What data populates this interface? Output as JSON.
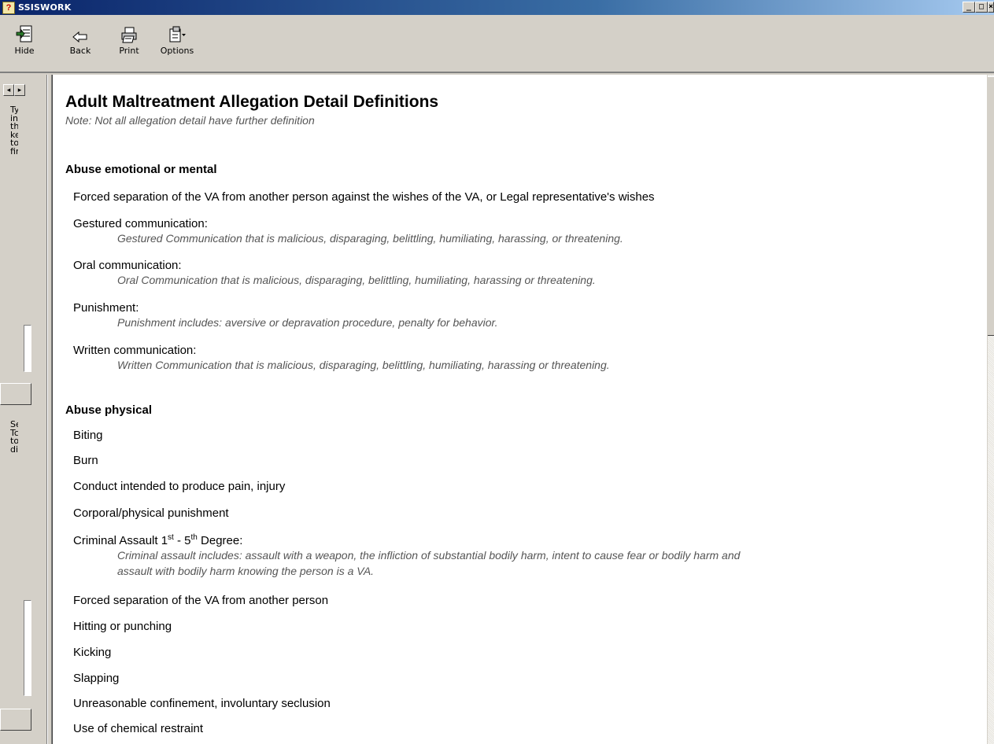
{
  "window": {
    "title": "SSISWORK"
  },
  "toolbar": {
    "hide_label": "Hide",
    "back_label": "Back",
    "print_label": "Print",
    "options_label": "Options"
  },
  "left_pane": {
    "text_top": [
      "Ty",
      "in",
      "th",
      "ke",
      "to",
      "fin"
    ],
    "text_bottom": [
      "Se",
      "Tc",
      "to",
      "dis"
    ]
  },
  "document": {
    "title": "Adult Maltreatment Allegation Detail Definitions",
    "note": "Note: Not all allegation detail have further definition",
    "section1": {
      "title": "Abuse emotional or mental",
      "item1": "Forced separation of the VA from another person against the wishes of the VA, or Legal representative's wishes",
      "item2": "Gestured communication:",
      "item2_def": "Gestured Communication that is malicious, disparaging, belittling, humiliating, harassing, or threatening.",
      "item3": "Oral communication:",
      "item3_def": "Oral Communication that is malicious, disparaging, belittling, humiliating, harassing or threatening.",
      "item4": "Punishment:",
      "item4_def": "Punishment includes: aversive or depravation procedure, penalty for behavior.",
      "item5": "Written communication:",
      "item5_def": "Written Communication that is malicious, disparaging, belittling, humiliating, harassing or threatening."
    },
    "section2": {
      "title": "Abuse physical",
      "item1": "Biting",
      "item2": "Burn",
      "item3": "Conduct intended to produce pain, injury",
      "item4": "Corporal/physical punishment",
      "item5_a": "Criminal Assault 1",
      "item5_sup1": "st",
      "item5_b": " - 5",
      "item5_sup2": "th",
      "item5_c": " Degree:",
      "item5_def_line1": "Criminal assault includes: assault with a weapon, the infliction of substantial bodily harm, intent to cause fear or bodily harm and",
      "item5_def_line2": "assault with bodily harm knowing the person is a VA.",
      "item6": "Forced separation of the VA from another person",
      "item7": "Hitting or punching",
      "item8": "Kicking",
      "item9": "Slapping",
      "item10": "Unreasonable confinement, involuntary seclusion",
      "item11": "Use of chemical restraint"
    }
  }
}
